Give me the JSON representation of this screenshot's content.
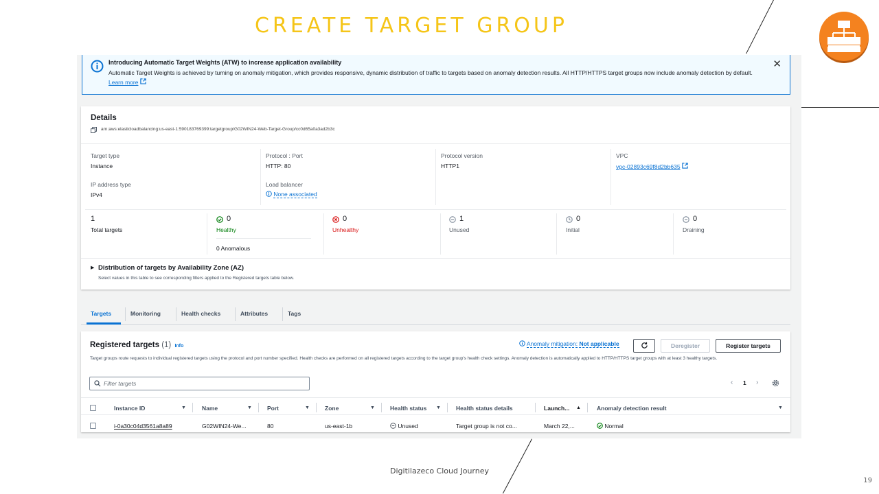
{
  "slide": {
    "title": "CREATE TARGET GROUP",
    "footer": "Digitilazeco Cloud Journey",
    "page_number": "19"
  },
  "flash": {
    "icon": "info-icon",
    "title": "Introducing Automatic Target Weights (ATW) to increase application availability",
    "body": "Automatic Target Weights is achieved by turning on anomaly mitigation, which provides responsive, dynamic distribution of traffic to targets based on anomaly detection results. All HTTP/HTTPS target groups now include anomaly detection by default.",
    "learn_more": "Learn more"
  },
  "details": {
    "heading": "Details",
    "arn": "arn:aws:elasticloadbalancing:us-east-1:590183769399:targetgroup/G02WIN24-Web-Target-Group/cc0d65a0a3ad2b3c",
    "target_type_label": "Target type",
    "target_type": "Instance",
    "protocol_port_label": "Protocol : Port",
    "protocol_port": "HTTP: 80",
    "protocol_version_label": "Protocol version",
    "protocol_version": "HTTP1",
    "vpc_label": "VPC",
    "vpc": "vpc-02893c69f8d2bb635",
    "ip_type_label": "IP address type",
    "ip_type": "IPv4",
    "lb_label": "Load balancer",
    "lb": "None associated"
  },
  "stats": {
    "total": "1",
    "total_label": "Total targets",
    "healthy": "0",
    "healthy_label": "Healthy",
    "anomalous": "0 Anomalous",
    "unhealthy": "0",
    "unhealthy_label": "Unhealthy",
    "unused": "1",
    "unused_label": "Unused",
    "initial": "0",
    "initial_label": "Initial",
    "draining": "0",
    "draining_label": "Draining"
  },
  "distribution": {
    "title": "Distribution of targets by Availability Zone (AZ)",
    "desc": "Select values in this table to see corresponding filters applied to the Registered targets table below."
  },
  "tabs": [
    "Targets",
    "Monitoring",
    "Health checks",
    "Attributes",
    "Tags"
  ],
  "registered": {
    "title": "Registered targets",
    "count": "(1)",
    "info": "Info",
    "mitigation_label": "Anomaly mitigation:",
    "mitigation_value": "Not applicable",
    "deregister": "Deregister",
    "register": "Register targets",
    "desc": "Target groups route requests to individual registered targets using the protocol and port number specified. Health checks are performed on all registered targets according to the target group's health check settings. Anomaly detection is automatically applied to HTTP/HTTPS target groups with at least 3 healthy targets.",
    "filter_placeholder": "Filter targets",
    "page": "1",
    "columns": [
      "Instance ID",
      "Name",
      "Port",
      "Zone",
      "Health status",
      "Health status details",
      "Launch...",
      "Anomaly detection result"
    ],
    "rows": [
      {
        "instance_id": "i-0a30c04d3561a8a89",
        "name": "G02WIN24-We...",
        "port": "80",
        "zone": "us-east-1b",
        "health": "Unused",
        "health_details": "Target group is not co...",
        "launch": "March 22,...",
        "anomaly": "Normal"
      }
    ]
  },
  "colors": {
    "title_yellow": "#f5c518",
    "logo_orange": "#f4821f",
    "aws_blue": "#0972d3",
    "healthy_green": "#037f0c",
    "unhealthy_red": "#d91515"
  }
}
